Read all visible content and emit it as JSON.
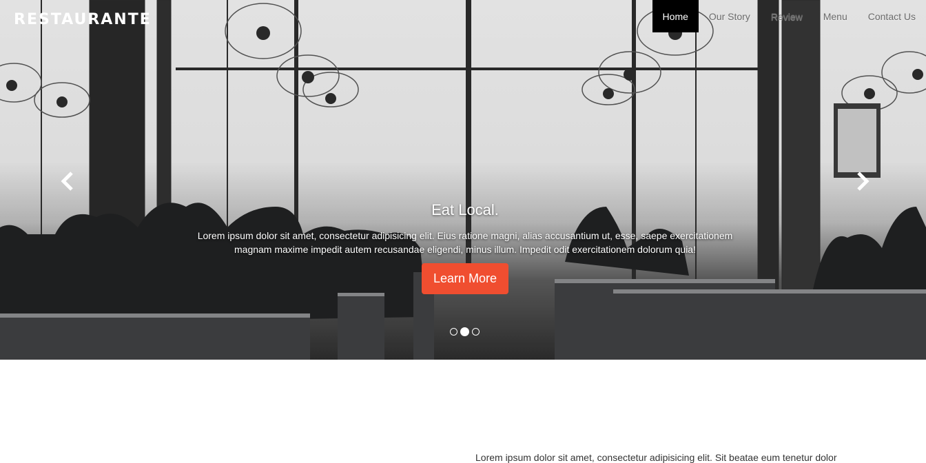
{
  "brand": {
    "logo": "RESTAURANTE"
  },
  "nav": {
    "items": [
      "Home",
      "Our Story",
      "Review",
      "Menu",
      "Contact Us"
    ],
    "active": "Home"
  },
  "hero": {
    "title": "Eat Local.",
    "text_line1": "Lorem ipsum dolor sit amet, consectetur adipisicing elit. Eius ratione magni, alias accusantium ut, esse, saepe exercitationem",
    "text_line2": "magnam maxime impedit autem recusandae eligendi, minus illum. Impedit odit exercitationem dolorum quia!",
    "cta_label": "Learn More",
    "slides_total": 3,
    "active_slide": 2
  },
  "intro": {
    "text": "Lorem ipsum dolor sit amet, consectetur adipisicing elit. Sit beatae eum tenetur dolor"
  },
  "colors": {
    "accent": "#f04e30",
    "nav_active_bg": "#000000"
  }
}
